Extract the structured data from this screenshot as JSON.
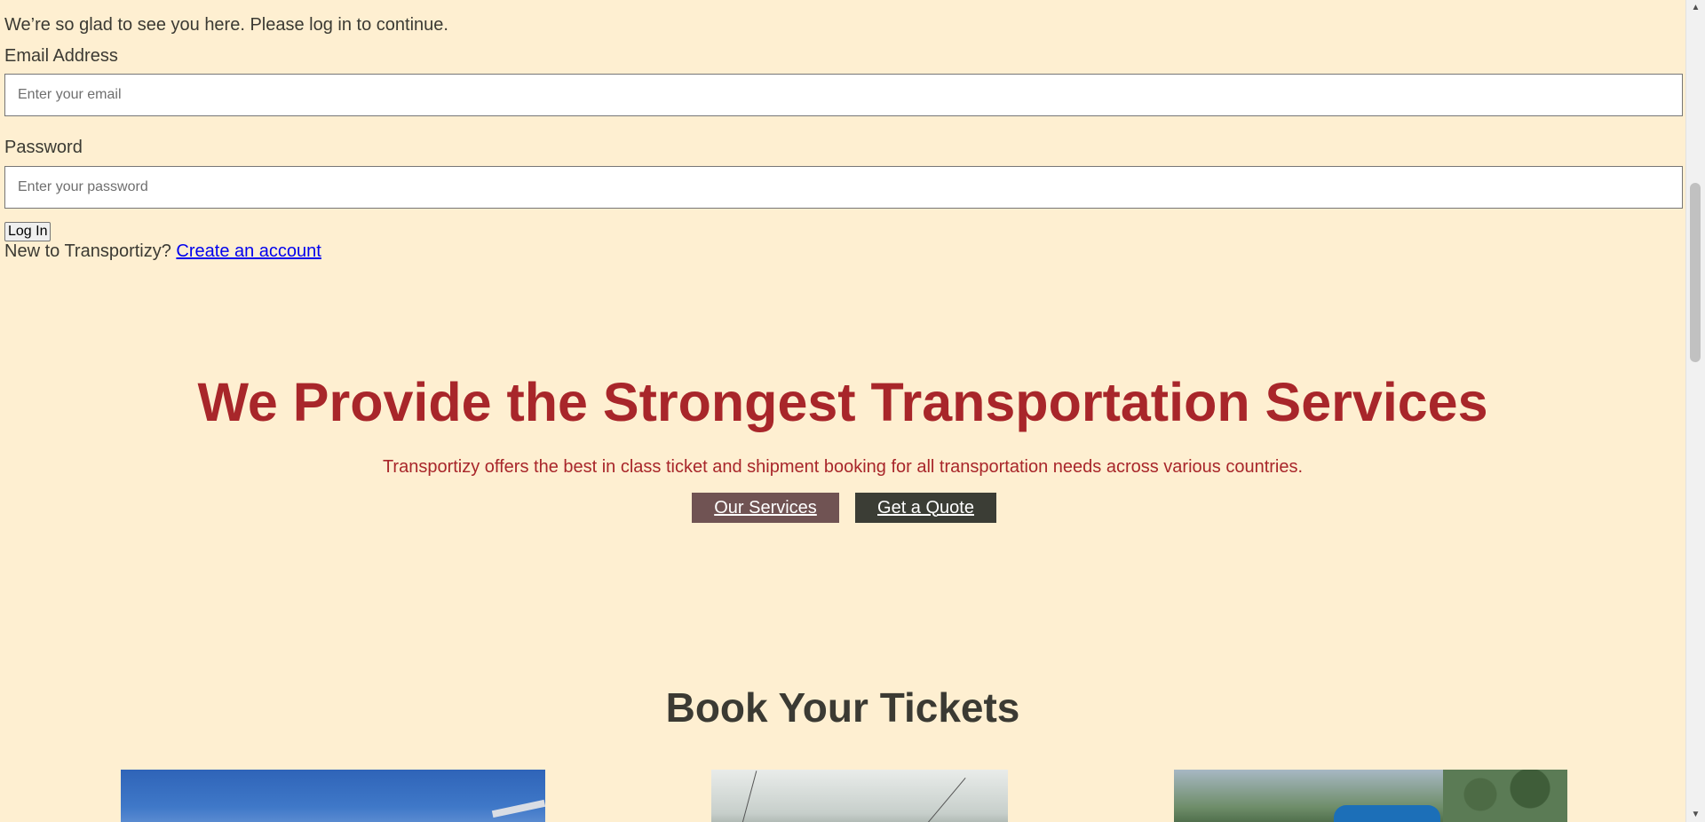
{
  "login": {
    "welcome": "We’re so glad to see you here. Please log in to continue.",
    "email_label": "Email Address",
    "email_placeholder": "Enter your email",
    "password_label": "Password",
    "password_placeholder": "Enter your password",
    "login_button": "Log In",
    "signup_prompt": "New to Transportizy?",
    "signup_link": "Create an account"
  },
  "hero": {
    "title": "We Provide the Strongest Transportation Services",
    "subtitle": "Transportizy offers the best in class ticket and shipment booking for all transportation needs across various countries.",
    "services_button": "Our Services",
    "quote_button": "Get a Quote"
  },
  "tickets": {
    "title": "Book Your Tickets",
    "images": [
      "airport-photo",
      "train-photo",
      "bus-photo"
    ]
  },
  "colors": {
    "background": "#feefd1",
    "accent": "#a8262a",
    "services_button": "#705353",
    "quote_button": "#3b3d35",
    "text": "#3b3a33"
  }
}
